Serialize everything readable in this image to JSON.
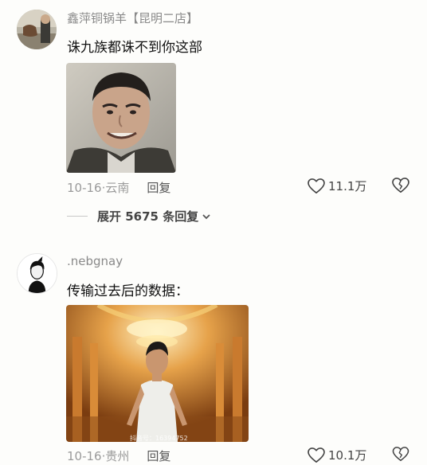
{
  "comments": [
    {
      "username": "鑫萍铜锅羊【昆明二店】",
      "text": "诛九族都诛不到你这部",
      "date": "10-16",
      "location": "云南",
      "reply_label": "回复",
      "likes": "11.1万",
      "expand_label": "展开 5675 条回复"
    },
    {
      "username": ".nebgnay",
      "text": "传输过去后的数据：",
      "date": "10-16",
      "location": "贵州",
      "reply_label": "回复",
      "likes": "10.1万",
      "watermark": "抖音号：16394752"
    }
  ],
  "icons": {
    "like": "heart-outline-icon",
    "dislike": "broken-heart-icon",
    "expand": "chevron-down-icon"
  },
  "colors": {
    "background": "#fdfdfb",
    "muted": "#9a9a9a",
    "text": "#111111"
  }
}
